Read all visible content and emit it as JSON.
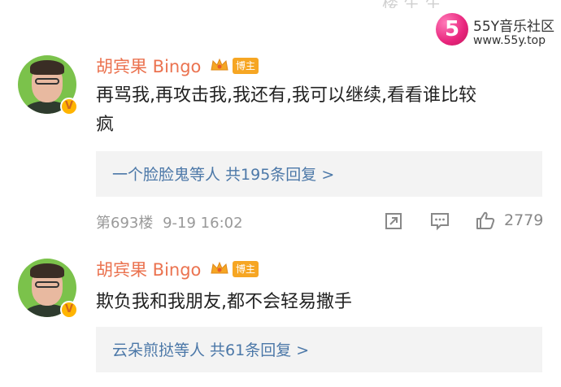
{
  "top_partial": "楼 生 生",
  "watermark": {
    "logo": "5",
    "title": "55Y音乐社区",
    "url": "www.55y.top"
  },
  "comments": [
    {
      "user": "胡宾果 Bingo",
      "badge": "博主",
      "text_line1": "再骂我,再攻击我,我还有,我可以继续,看看谁比较",
      "text_line2": "疯",
      "reply_summary": "一个脸脸鬼等人  共195条回复 >",
      "floor": "第693楼",
      "time": "9-19 16:02",
      "likes": "2779"
    },
    {
      "user": "胡宾果 Bingo",
      "badge": "博主",
      "text_line1": "欺负我和我朋友,都不会轻易撒手",
      "reply_summary": "云朵煎挞等人  共61条回复 >"
    }
  ],
  "icons": {
    "share": "share-icon",
    "comment": "comment-icon",
    "like": "thumbs-up-icon",
    "crown": "crown-icon",
    "verified": "verified-v-icon"
  },
  "colors": {
    "username": "#eb7350",
    "reply_link": "#4c78a8",
    "badge": "#f6a623",
    "meta": "#999999"
  }
}
